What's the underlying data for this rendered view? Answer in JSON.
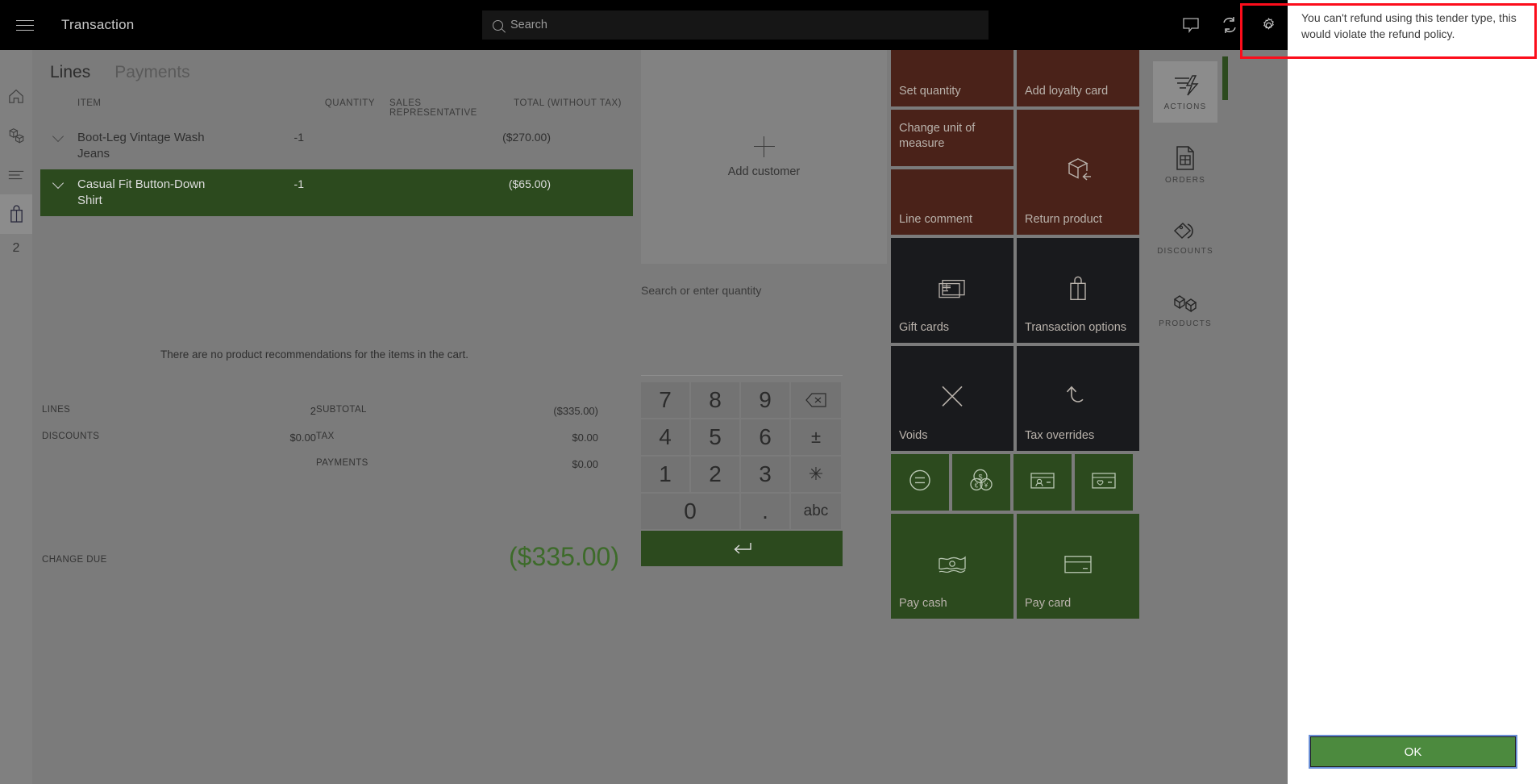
{
  "header": {
    "title": "Transaction",
    "menu_icon": "hamburger-icon",
    "search_placeholder": "Search",
    "icons": [
      "notifications-icon",
      "sync-icon",
      "settings-icon"
    ]
  },
  "left_rail": {
    "items": [
      {
        "name": "home-icon",
        "label": "Home"
      },
      {
        "name": "products-icon",
        "label": "Products"
      },
      {
        "name": "journal-icon",
        "label": "Journal"
      },
      {
        "name": "cart-icon",
        "label": "Cart",
        "active": true
      }
    ],
    "cart_count": "2"
  },
  "cart": {
    "tabs": [
      {
        "label": "Lines",
        "active": true
      },
      {
        "label": "Payments",
        "active": false
      }
    ],
    "columns": {
      "item": "ITEM",
      "quantity": "QUANTITY",
      "sales_representative": "SALES REPRESENTATIVE",
      "total": "TOTAL (WITHOUT TAX)"
    },
    "lines": [
      {
        "item": "Boot-Leg Vintage Wash Jeans",
        "quantity": "-1",
        "rep": "",
        "total": "($270.00)",
        "selected": false
      },
      {
        "item": "Casual Fit Button-Down Shirt",
        "quantity": "-1",
        "rep": "",
        "total": "($65.00)",
        "selected": true
      }
    ],
    "no_recommendations": "There are no product recommendations for the items in the cart.",
    "totals": {
      "lines_label": "LINES",
      "lines_value": "2",
      "discounts_label": "DISCOUNTS",
      "discounts_value": "$0.00",
      "subtotal_label": "SUBTOTAL",
      "subtotal_value": "($335.00)",
      "tax_label": "TAX",
      "tax_value": "$0.00",
      "payments_label": "PAYMENTS",
      "payments_value": "$0.00",
      "change_due_label": "CHANGE DUE",
      "change_due_value": "($335.00)"
    }
  },
  "customer": {
    "add_label": "Add customer",
    "add_icon": "plus-icon"
  },
  "numpad": {
    "prompt": "Search or enter quantity",
    "keys": [
      "7",
      "8",
      "9",
      "4",
      "5",
      "6",
      "1",
      "2",
      "3"
    ],
    "backspace": "backspace-icon",
    "plusminus": "±",
    "asterisk": "✳",
    "zero": "0",
    "dot": ".",
    "abc": "abc",
    "enter": "enter-icon"
  },
  "tiles": [
    {
      "label": "Set quantity",
      "style": "brown",
      "icon": ""
    },
    {
      "label": "Add loyalty card",
      "style": "brown",
      "icon": ""
    },
    {
      "label": "Change unit of measure",
      "style": "brown",
      "icon": ""
    },
    {
      "label": "Return product",
      "style": "brown",
      "icon": "return-product-icon"
    },
    {
      "label": "Line comment",
      "style": "brown",
      "icon": ""
    },
    {
      "label": "Gift cards",
      "style": "dark",
      "icon": "gift-card-icon"
    },
    {
      "label": "Transaction options",
      "style": "dark",
      "icon": "shopping-bag-icon"
    },
    {
      "label": "Voids",
      "style": "dark",
      "icon": "close-x-icon"
    },
    {
      "label": "Tax overrides",
      "style": "dark",
      "icon": "undo-arrow-icon"
    },
    {
      "label": "",
      "style": "green",
      "icon": "exact-amount-icon"
    },
    {
      "label": "",
      "style": "green",
      "icon": "currency-coins-icon"
    },
    {
      "label": "",
      "style": "green",
      "icon": "customer-account-icon"
    },
    {
      "label": "",
      "style": "green",
      "icon": "loyalty-card-icon"
    },
    {
      "label": "Pay cash",
      "style": "green",
      "icon": "cash-icon"
    },
    {
      "label": "Pay card",
      "style": "green",
      "icon": "credit-card-icon"
    }
  ],
  "nav_rail": [
    {
      "label": "ACTIONS",
      "icon": "actions-icon",
      "active": true
    },
    {
      "label": "ORDERS",
      "icon": "orders-icon",
      "active": false
    },
    {
      "label": "DISCOUNTS",
      "icon": "discounts-icon",
      "active": false
    },
    {
      "label": "PRODUCTS",
      "icon": "products-cubes-icon",
      "active": false
    }
  ],
  "dialog": {
    "message": "You can't refund using this tender type, this would violate the refund policy.",
    "ok_label": "OK"
  },
  "colors": {
    "accent_green": "#2c4a1e",
    "tile_brown": "#4a2219",
    "tile_dark": "#191a1d",
    "ok_button_green": "#4c8a3e",
    "highlight_red": "#fc0d1b",
    "dim_overlay": "#7b7b7b"
  }
}
